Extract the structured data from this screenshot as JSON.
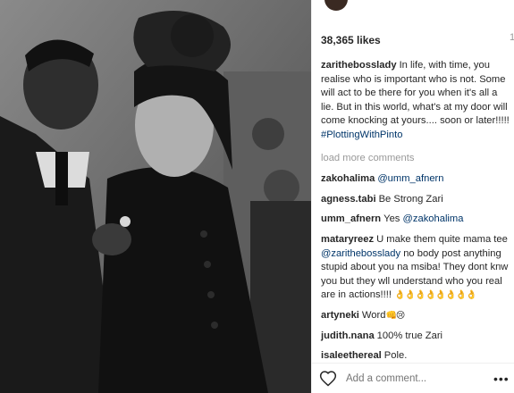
{
  "post": {
    "likes": "38,365 likes",
    "caption": {
      "user": "zarithebosslady",
      "text": "In life, with time, you realise who is important who is not. Some will act to be there for you when it's all a lie. But in this world, what's at my door will come knocking at yours.... soon or later!!!!! ",
      "hashtag": "#PlottingWithPinto"
    },
    "load_more": "load more comments",
    "comments": [
      {
        "user": "zakohalima",
        "mention": "@umm_afnern",
        "text": ""
      },
      {
        "user": "agness.tabi",
        "text": "Be Strong Zari"
      },
      {
        "user": "umm_afnern",
        "text": "Yes ",
        "mention": "@zakohalima"
      },
      {
        "user": "mataryreez",
        "text_before": "U make them quite mama tee ",
        "mention": "@zarithebosslady",
        "text_after": " no body post anything stupid about you na msiba! They dont knw you but they wll understand who you real are in actions!!!! ",
        "emoji": "👌👌👌👌👌👌👌👌"
      },
      {
        "user": "artyneki",
        "text": "Word",
        "emoji": "👊😢"
      },
      {
        "user": "judith.nana",
        "text": "100% true Zari"
      },
      {
        "user": "isaleethereal",
        "text": "Pole."
      }
    ],
    "add_comment_placeholder": "Add a comment...",
    "more_label": "•••",
    "scroll_mark": "1"
  },
  "icons": {
    "like": "heart-outline-icon",
    "options": "more-options-icon"
  }
}
